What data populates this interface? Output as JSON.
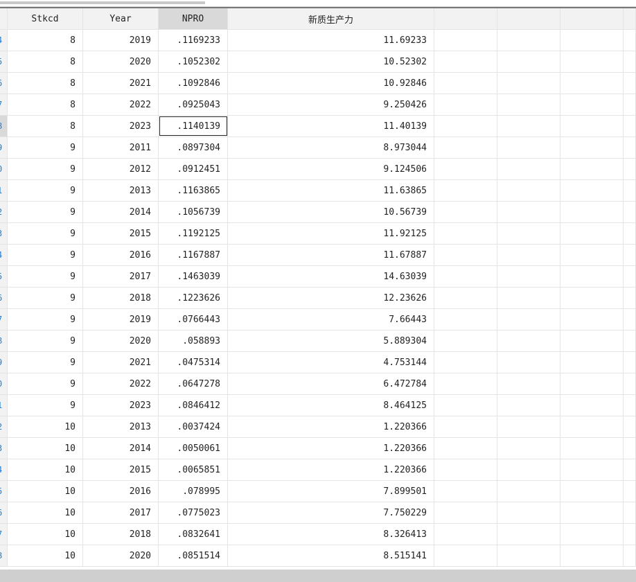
{
  "columns": [
    "Stkcd",
    "Year",
    "NPRO",
    "新质生产力"
  ],
  "rows": [
    {
      "n": "4",
      "s": "8",
      "y": "2019",
      "p": ".1169233",
      "q": "11.69233"
    },
    {
      "n": "5",
      "s": "8",
      "y": "2020",
      "p": ".1052302",
      "q": "10.52302"
    },
    {
      "n": "6",
      "s": "8",
      "y": "2021",
      "p": ".1092846",
      "q": "10.92846"
    },
    {
      "n": "7",
      "s": "8",
      "y": "2022",
      "p": ".0925043",
      "q": "9.250426"
    },
    {
      "n": "8",
      "s": "8",
      "y": "2023",
      "p": ".1140139",
      "q": "11.40139"
    },
    {
      "n": "9",
      "s": "9",
      "y": "2011",
      "p": ".0897304",
      "q": "8.973044"
    },
    {
      "n": "0",
      "s": "9",
      "y": "2012",
      "p": ".0912451",
      "q": "9.124506"
    },
    {
      "n": "1",
      "s": "9",
      "y": "2013",
      "p": ".1163865",
      "q": "11.63865"
    },
    {
      "n": "2",
      "s": "9",
      "y": "2014",
      "p": ".1056739",
      "q": "10.56739"
    },
    {
      "n": "3",
      "s": "9",
      "y": "2015",
      "p": ".1192125",
      "q": "11.92125"
    },
    {
      "n": "4",
      "s": "9",
      "y": "2016",
      "p": ".1167887",
      "q": "11.67887"
    },
    {
      "n": "5",
      "s": "9",
      "y": "2017",
      "p": ".1463039",
      "q": "14.63039"
    },
    {
      "n": "6",
      "s": "9",
      "y": "2018",
      "p": ".1223626",
      "q": "12.23626"
    },
    {
      "n": "7",
      "s": "9",
      "y": "2019",
      "p": ".0766443",
      "q": "7.66443"
    },
    {
      "n": "8",
      "s": "9",
      "y": "2020",
      "p": ".058893",
      "q": "5.889304"
    },
    {
      "n": "9",
      "s": "9",
      "y": "2021",
      "p": ".0475314",
      "q": "4.753144"
    },
    {
      "n": "0",
      "s": "9",
      "y": "2022",
      "p": ".0647278",
      "q": "6.472784"
    },
    {
      "n": "1",
      "s": "9",
      "y": "2023",
      "p": ".0846412",
      "q": "8.464125"
    },
    {
      "n": "2",
      "s": "10",
      "y": "2013",
      "p": ".0037424",
      "q": "1.220366"
    },
    {
      "n": "3",
      "s": "10",
      "y": "2014",
      "p": ".0050061",
      "q": "1.220366"
    },
    {
      "n": "4",
      "s": "10",
      "y": "2015",
      "p": ".0065851",
      "q": "1.220366"
    },
    {
      "n": "5",
      "s": "10",
      "y": "2016",
      "p": ".078995",
      "q": "7.899501"
    },
    {
      "n": "6",
      "s": "10",
      "y": "2017",
      "p": ".0775023",
      "q": "7.750229"
    },
    {
      "n": "7",
      "s": "10",
      "y": "2018",
      "p": ".0832641",
      "q": "8.326413"
    },
    {
      "n": "8",
      "s": "10",
      "y": "2020",
      "p": ".0851514",
      "q": "8.515141"
    }
  ]
}
